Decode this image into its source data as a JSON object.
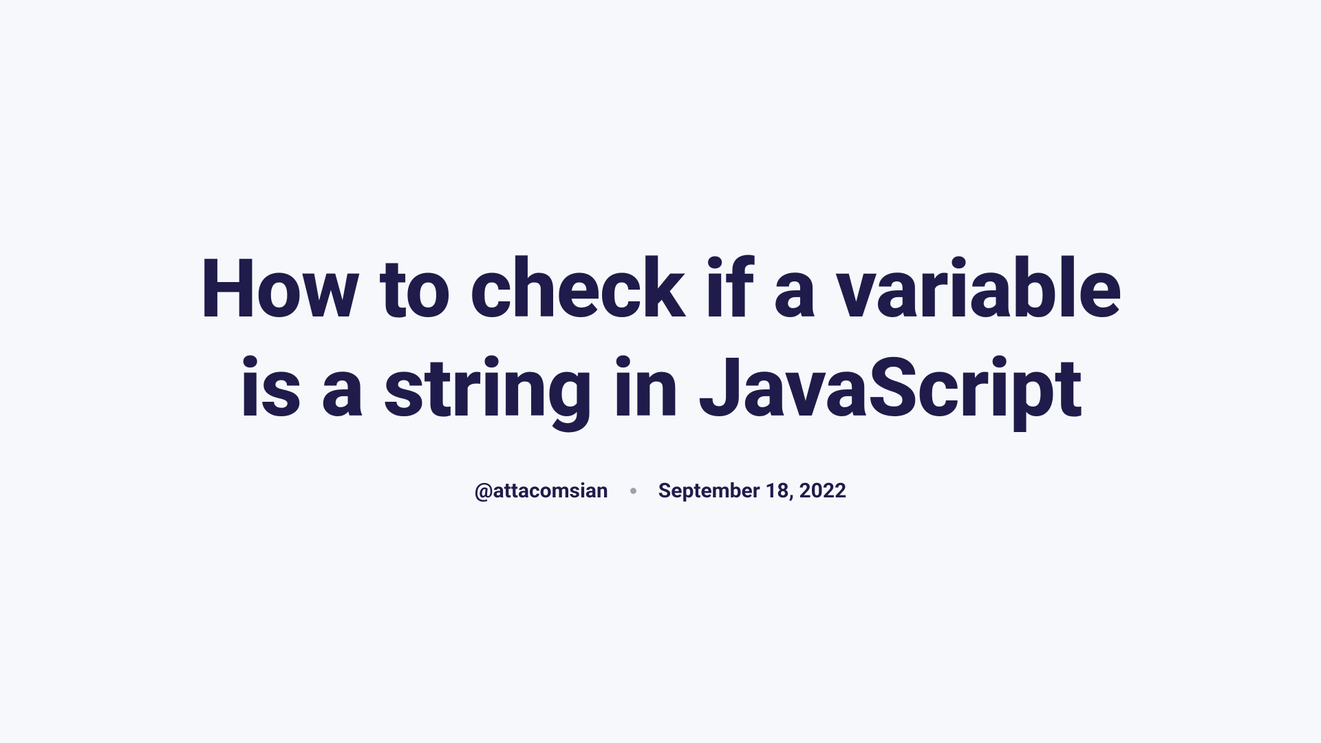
{
  "article": {
    "title": "How to check if a variable is a string in JavaScript",
    "author": "@attacomsian",
    "date": "September 18, 2022"
  }
}
